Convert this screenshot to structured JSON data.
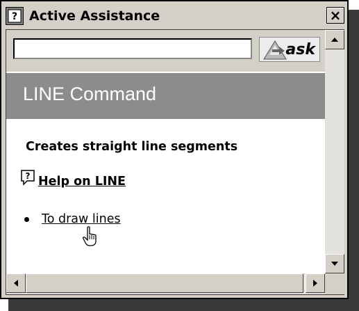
{
  "window": {
    "title": "Active Assistance",
    "close_label": "×"
  },
  "toolbar": {
    "query_value": "",
    "query_placeholder": "",
    "ask_label": "ask"
  },
  "header": {
    "title": "LINE Command"
  },
  "content": {
    "description": "Creates straight line segments",
    "help_link": "Help on LINE",
    "tasks": [
      "To draw lines"
    ]
  },
  "icons": {
    "title": "help-question-icon",
    "ask": "ask-arrow-icon",
    "help": "help-question-icon",
    "cursor": "hand-pointer-icon"
  },
  "colors": {
    "window_bg": "#d4d0c8",
    "header_band": "#8c8c8c",
    "header_text": "#ffffff"
  }
}
